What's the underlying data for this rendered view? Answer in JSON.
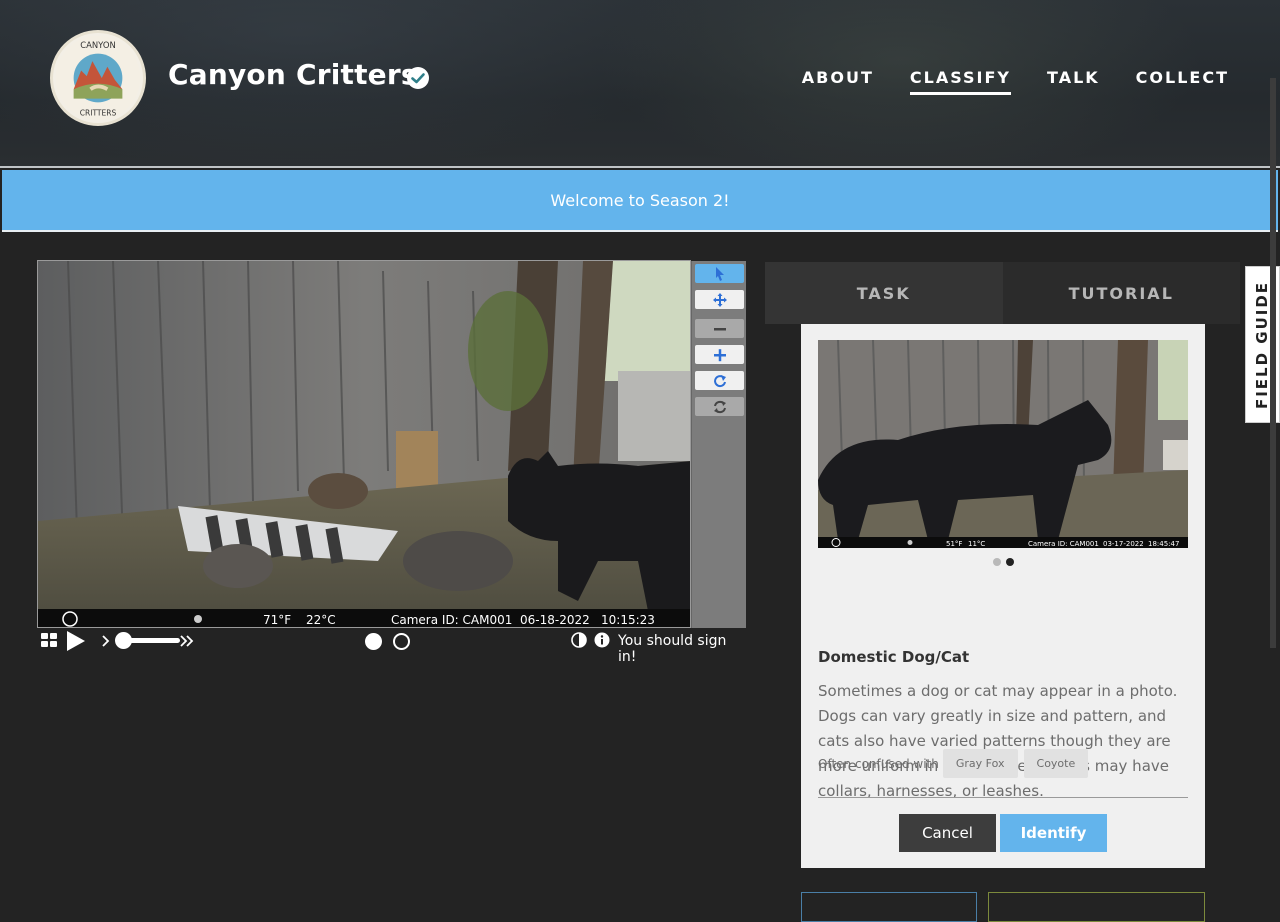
{
  "project": {
    "title": "Canyon Critters",
    "logo_text_top": "CANYON",
    "logo_text_bottom": "CRITTERS",
    "verified_icon": "check-circle-icon"
  },
  "nav": {
    "items": [
      {
        "label": "ABOUT"
      },
      {
        "label": "CLASSIFY"
      },
      {
        "label": "TALK"
      },
      {
        "label": "COLLECT"
      }
    ],
    "active": "CLASSIFY"
  },
  "banner": {
    "message": "Welcome to Season 2!"
  },
  "viewer": {
    "overlay": {
      "temp_f": "71°F",
      "temp_c": "22°C",
      "camera": "Camera ID: CAM001",
      "date": "06-18-2022",
      "time": "10:15:23"
    },
    "tools": [
      "pointer-icon",
      "move-icon",
      "zoom-out-icon",
      "zoom-in-icon",
      "rotate-icon",
      "reset-icon"
    ],
    "controls": {
      "sign_in_text": "You should sign in!",
      "frames": 2,
      "current_frame": 1
    }
  },
  "task": {
    "tabs": [
      {
        "label": "TASK"
      },
      {
        "label": "TUTORIAL"
      }
    ],
    "active_tab": "TASK",
    "choice": {
      "image_overlay": {
        "temp_f": "51°F",
        "temp_c": "11°C",
        "camera": "Camera ID: CAM001",
        "date": "03-17-2022",
        "time": "18:45:47"
      },
      "images_count": 2,
      "current_image": 2,
      "name": "Domestic Dog/Cat",
      "description": "Sometimes a dog or cat may appear in a photo. Dogs can vary greatly in size and pattern, and cats also have varied patterns though they are more uniform in size. These animals may have collars, harnesses, or leashes.",
      "confused_label": "Often confused with",
      "confused_with": [
        "Gray Fox",
        "Coyote"
      ],
      "cancel_label": "Cancel",
      "identify_label": "Identify"
    }
  },
  "field_guide": {
    "label": "FIELD GUIDE"
  },
  "colors": {
    "accent": "#63b4ec",
    "background": "#232323",
    "card": "#f0f0f0",
    "cancel": "#3d3d3d"
  }
}
